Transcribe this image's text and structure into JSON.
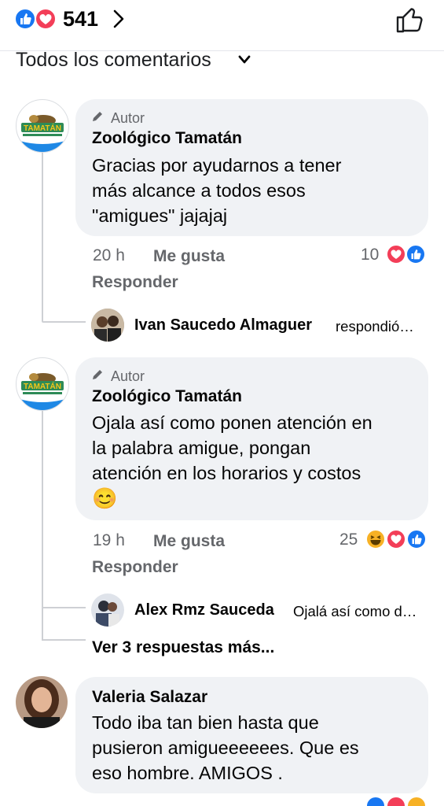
{
  "header": {
    "reaction_count": "541",
    "reaction_icons": [
      "like-icon",
      "love-icon"
    ],
    "chevron_icon": "chevron-right-icon",
    "like_button_icon": "thumbs-up-outline-icon"
  },
  "filter": {
    "label": "Todos los comentarios",
    "icon": "chevron-down-icon"
  },
  "comments": [
    {
      "author_tag": "Autor",
      "author_tag_icon": "pencil-icon",
      "name": "Zoológico Tamatán",
      "avatar_logo_text": "TAMATÁN",
      "text_lines": [
        "Gracias por ayudarnos a tener",
        "más alcance a todos esos",
        "\"amigues\" jajajaj"
      ],
      "time": "20 h",
      "like_label": "Me gusta",
      "reply_label": "Responder",
      "reaction_count": "10",
      "reactions": [
        "love-icon",
        "like-icon"
      ],
      "reply_preview": {
        "name": "Ivan Saucedo Almaguer",
        "snippet": "respondió…"
      }
    },
    {
      "author_tag": "Autor",
      "author_tag_icon": "pencil-icon",
      "name": "Zoológico Tamatán",
      "avatar_logo_text": "TAMATÁN",
      "text_lines": [
        "Ojala así como ponen atención en",
        "la palabra amigue, pongan",
        "atención en los horarios y costos"
      ],
      "emoji": "😊",
      "time": "19 h",
      "like_label": "Me gusta",
      "reply_label": "Responder",
      "reaction_count": "25",
      "reactions": [
        "haha-icon",
        "love-icon",
        "like-icon"
      ],
      "reply_preview": {
        "name": "Alex Rmz Sauceda",
        "snippet": "Ojalá así como d…"
      },
      "more_replies": "Ver 3 respuestas más..."
    },
    {
      "name": "Valeria Salazar",
      "text_lines": [
        "Todo iba tan bien  hasta que",
        "pusieron amigueeeeees. Que es",
        "eso hombre. AMIGOS ."
      ]
    }
  ],
  "colors": {
    "like_blue": "#1877f2",
    "love_red": "#f33e58",
    "bubble": "#f0f2f5",
    "secondary_text": "#65676b"
  }
}
